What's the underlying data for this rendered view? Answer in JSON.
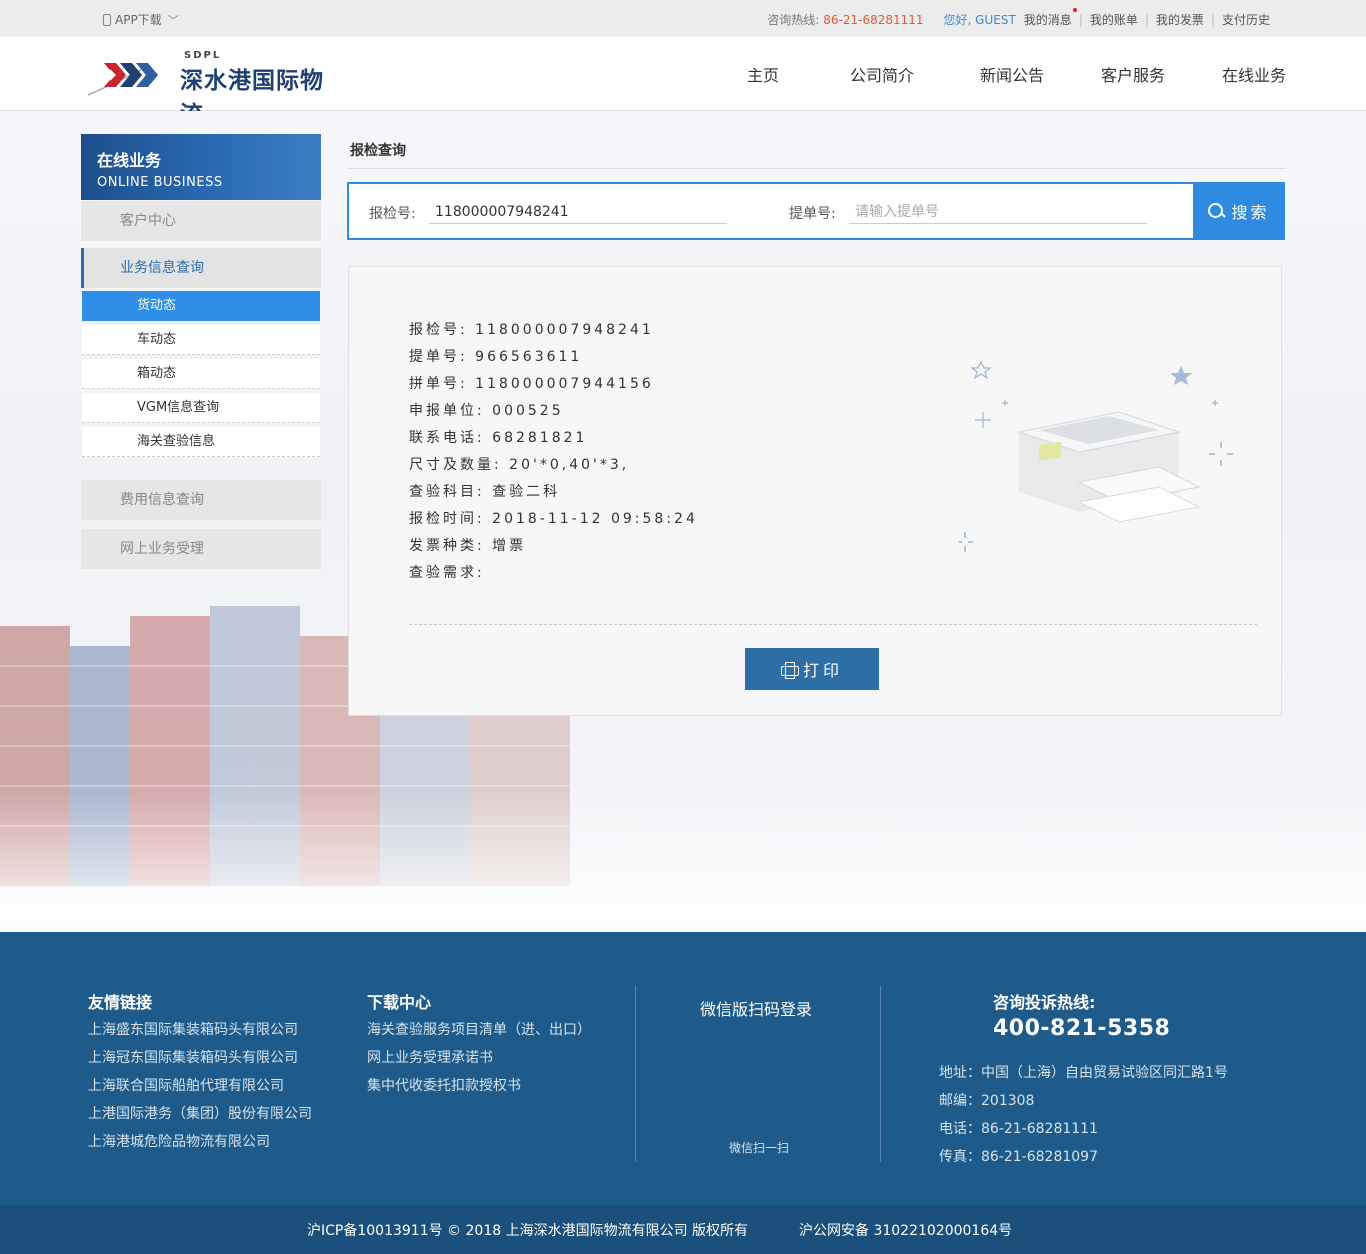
{
  "topbar": {
    "app_download": "APP下载",
    "hotline_label": "咨询热线:",
    "hotline_number": "86-21-68281111",
    "greeting": "您好, GUEST",
    "links": [
      "我的消息",
      "我的账单",
      "我的发票",
      "支付历史"
    ]
  },
  "header": {
    "logo_en": "SDPL",
    "logo_cn": "深水港国际物流",
    "nav": [
      "主页",
      "公司简介",
      "新闻公告",
      "客户服务",
      "在线业务"
    ]
  },
  "sidebar": {
    "title_cn": "在线业务",
    "title_en": "ONLINE BUSINESS",
    "sections": {
      "customer_center": "客户中心",
      "business_query": "业务信息查询",
      "fee_query": "费用信息查询",
      "online_accept": "网上业务受理"
    },
    "items": [
      "货动态",
      "车动态",
      "箱动态",
      "VGM信息查询",
      "海关查验信息"
    ]
  },
  "content": {
    "title": "报检查询",
    "search": {
      "inspection_label": "报检号:",
      "inspection_value": "118000007948241",
      "bl_label": "提单号:",
      "bl_placeholder": "请输入提单号",
      "button": "搜索"
    },
    "result": [
      {
        "label": "报检号:",
        "value": "118000007948241"
      },
      {
        "label": "提单号:",
        "value": "966563611"
      },
      {
        "label": "拼单号:",
        "value": "118000007944156"
      },
      {
        "label": "申报单位:",
        "value": "000525"
      },
      {
        "label": "联系电话:",
        "value": "68281821"
      },
      {
        "label": "尺寸及数量:",
        "value": "20'*0,40'*3,"
      },
      {
        "label": "查验科目:",
        "value": "查验二科"
      },
      {
        "label": "报检时间:",
        "value": "2018-11-12 09:58:24"
      },
      {
        "label": "发票种类:",
        "value": "增票"
      },
      {
        "label": "查验需求:",
        "value": ""
      }
    ],
    "print_button": "打印"
  },
  "footer": {
    "friend_links_title": "友情链接",
    "friend_links": [
      "上海盛东国际集装箱码头有限公司",
      "上海冠东国际集装箱码头有限公司",
      "上海联合国际船舶代理有限公司",
      "上港国际港务（集团）股份有限公司",
      "上海港城危险品物流有限公司"
    ],
    "download_title": "下载中心",
    "downloads": [
      "海关查验服务项目清单（进、出口）",
      "网上业务受理承诺书",
      "集中代收委托扣款授权书"
    ],
    "wechat_title": "微信版扫码登录",
    "wechat_caption": "微信扫一扫",
    "hotline_title": "咨询投诉热线:",
    "hotline_number": "400-821-5358",
    "address": "地址：中国（上海）自由贸易试验区同汇路1号",
    "postcode": "邮编：201308",
    "phone": "电话：86-21-68281111",
    "fax": "传真：86-21-68281097",
    "icp": "沪ICP备10013911号 © 2018  上海深水港国际物流有限公司 版权所有",
    "police": "沪公网安备 31022102000164号"
  },
  "colors": {
    "primary_blue": "#2f8be0",
    "footer_blue": "#1f5b8a",
    "print_button": "#2d6ea7",
    "hotline_red": "#e05a3a"
  }
}
